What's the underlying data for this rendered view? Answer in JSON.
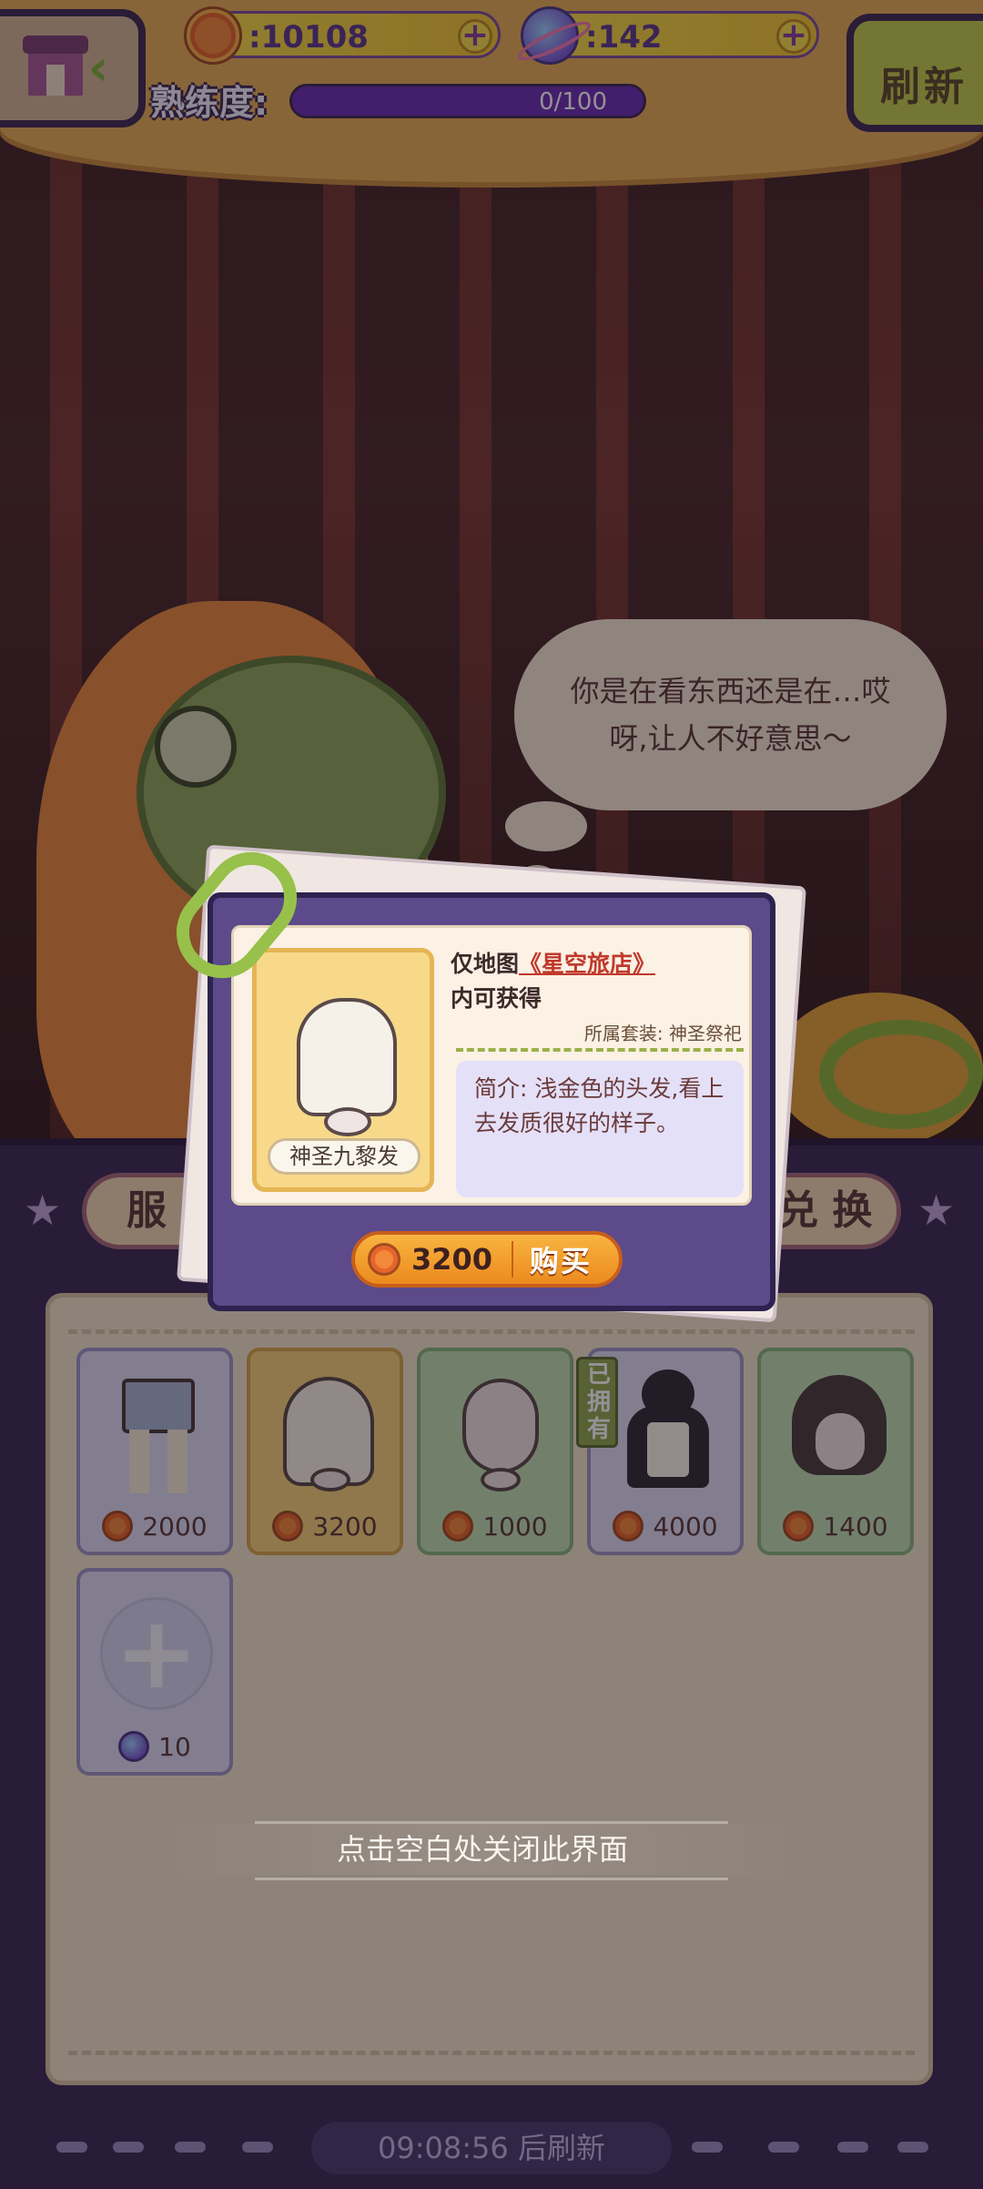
{
  "hud": {
    "coins": ":10108",
    "gems": ":142",
    "proficiency_label": "熟练度:",
    "proficiency_value": "0/100",
    "proficiency_fraction": 0.0,
    "refresh_label": "刷新"
  },
  "speech_bubble": "你是在看东西还是在…哎呀,让人不好意思～",
  "tabs": {
    "left": "服",
    "right": "兑 换"
  },
  "items": [
    {
      "price": "2000",
      "art": "pants"
    },
    {
      "price": "3200",
      "art": "blonde-hair"
    },
    {
      "price": "1000",
      "art": "bald-head"
    },
    {
      "price": "4000",
      "art": "maid-outfit",
      "owned_tag": "已拥有"
    },
    {
      "price": "1400",
      "art": "dark-hair"
    },
    {
      "price": "10",
      "art": "add-slot",
      "currency": "gem"
    }
  ],
  "close_hint": "点击空白处关闭此界面",
  "popup": {
    "item_name": "神圣九黎发",
    "source_prefix": "仅地图",
    "source_map": "《星空旅店》",
    "source_suffix": "内可获得",
    "set_line": "所属套装: 神圣祭祀",
    "description": "简介: 浅金色的头发,看上去发质很好的样子。",
    "price": "3200",
    "buy_label": "购买"
  },
  "footer": {
    "refresh_timer": "09:08:56  后刷新"
  },
  "colors": {
    "panel": "#3a2a57",
    "coin_pill": "#f7df4a",
    "buy_button": "#ec8a1e",
    "owned_tag": "#8fa84f"
  }
}
